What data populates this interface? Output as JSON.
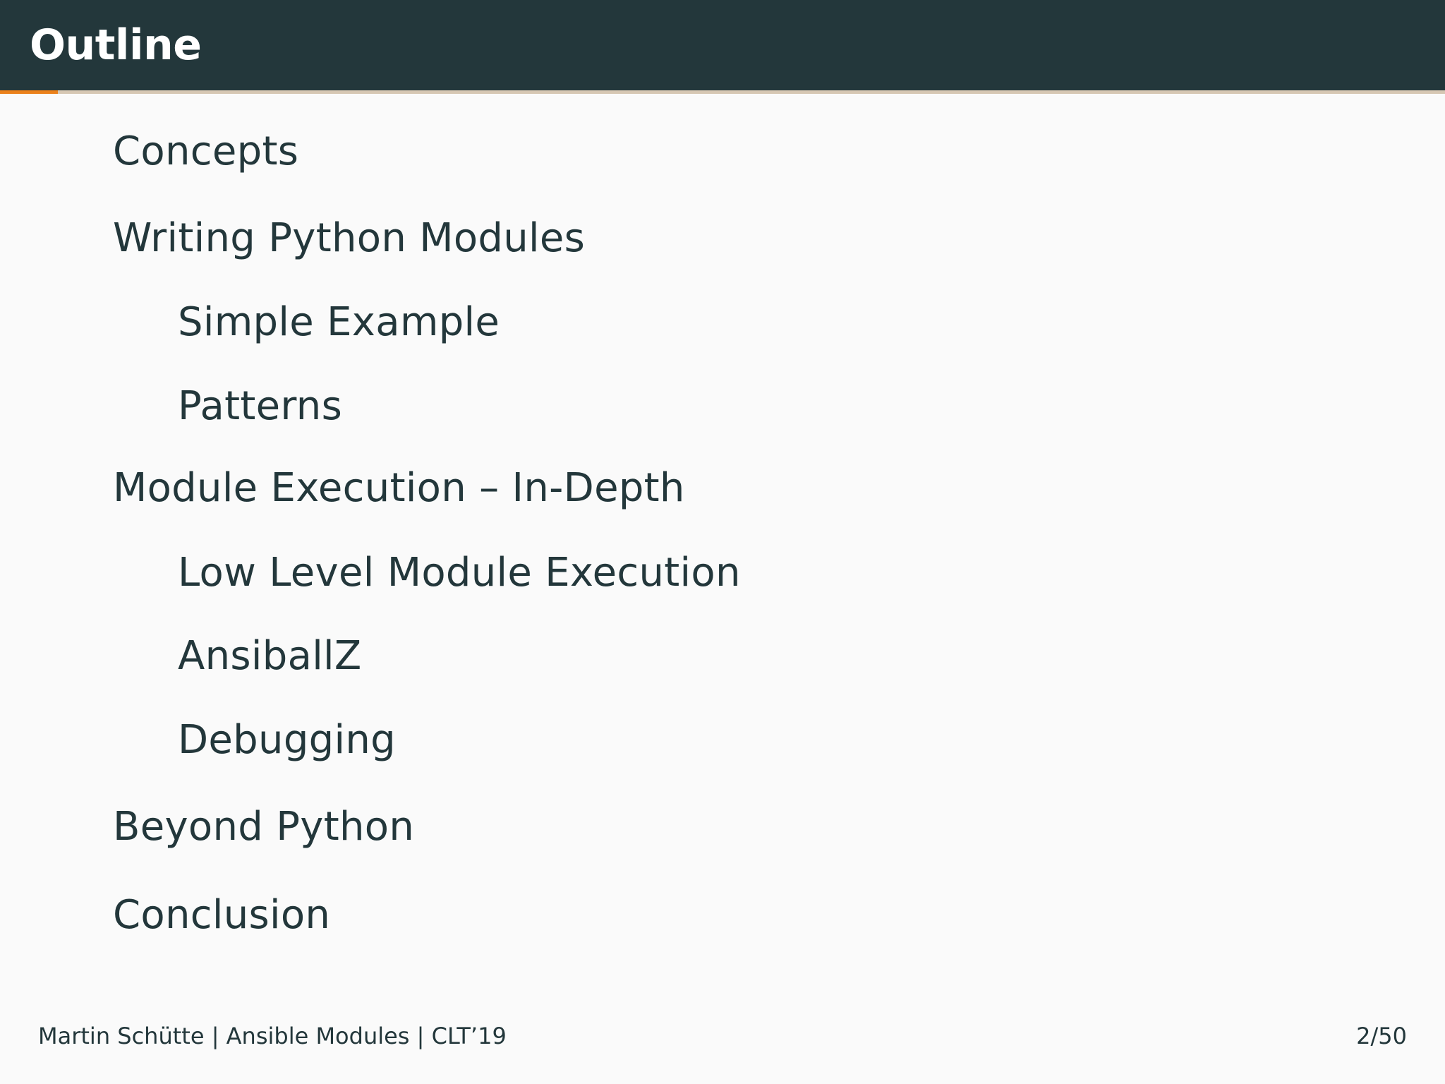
{
  "title": "Outline",
  "progress": {
    "current": 2,
    "total": 50
  },
  "toc": [
    {
      "text": "Concepts",
      "level": "section"
    },
    {
      "text": "Writing Python Modules",
      "level": "section"
    },
    {
      "text": "Simple Example",
      "level": "subsection"
    },
    {
      "text": "Patterns",
      "level": "subsection"
    },
    {
      "text": "Module Execution – In-Depth",
      "level": "section"
    },
    {
      "text": "Low Level Module Execution",
      "level": "subsection"
    },
    {
      "text": "AnsiballZ",
      "level": "subsection"
    },
    {
      "text": "Debugging",
      "level": "subsection"
    },
    {
      "text": "Beyond Python",
      "level": "section"
    },
    {
      "text": "Conclusion",
      "level": "section"
    }
  ],
  "footer": {
    "left": "Martin Schütte | Ansible Modules | CLT’19",
    "page": "2/50"
  },
  "colors": {
    "header": "#23373b",
    "accent": "#eb811b",
    "background": "#fafafa",
    "text": "#23373b"
  }
}
